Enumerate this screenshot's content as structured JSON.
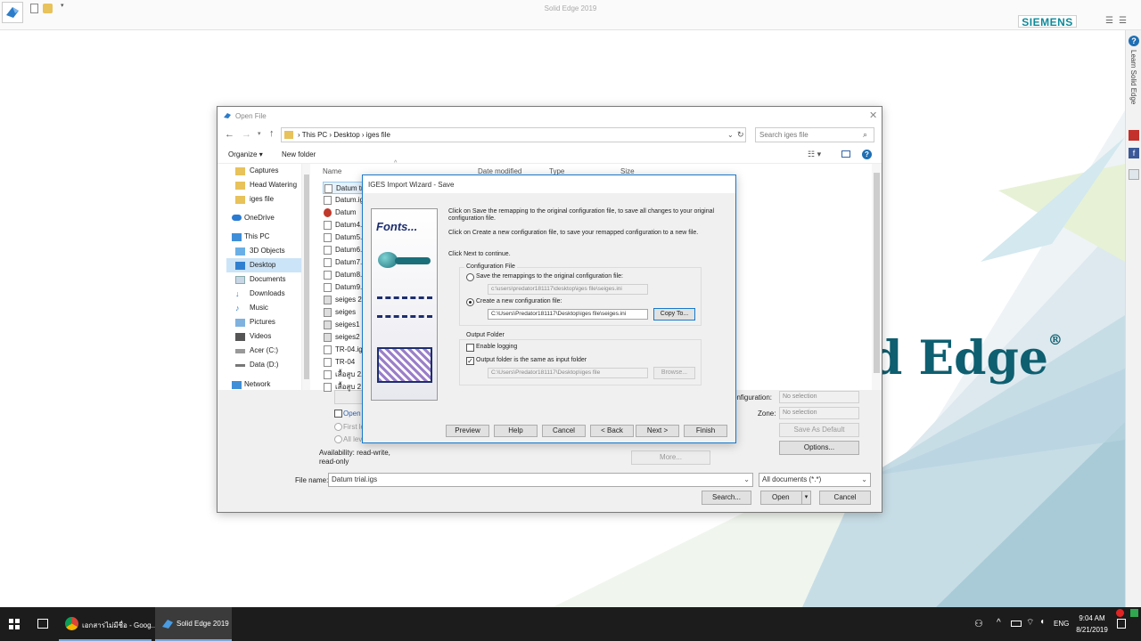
{
  "app": {
    "title": "Solid Edge 2019",
    "brand": "SIEMENS",
    "logo_text": "d Edge",
    "logo_reg": "®",
    "accent": "#0e6b7b"
  },
  "side_tab": {
    "label": "Learn Solid Edge",
    "help": "?"
  },
  "open_file": {
    "title": "Open File",
    "breadcrumb": [
      "This PC",
      "Desktop",
      "iges file"
    ],
    "search_placeholder": "Search iges file",
    "organize": "Organize",
    "new_folder": "New folder",
    "nav": [
      "Captures",
      "Head Watering",
      "iges file",
      "OneDrive",
      "This PC",
      "3D Objects",
      "Desktop",
      "Documents",
      "Downloads",
      "Music",
      "Pictures",
      "Videos",
      "Acer (C:)",
      "Data (D:)",
      "Network"
    ],
    "columns": [
      "Name",
      "Date modified",
      "Type",
      "Size"
    ],
    "files": [
      "Datum tr",
      "Datum.ig",
      "Datum",
      "Datum4.",
      "Datum5.",
      "Datum6.",
      "Datum7.",
      "Datum8.",
      "Datum9.",
      "seiges 2",
      "seiges",
      "seiges1",
      "seiges2",
      "TR-04.ig",
      "TR-04",
      "เสื้อสูบ 2.i",
      "เสื้อสูบ 2"
    ],
    "open_readonly": "Open",
    "first_level": "First le",
    "all_levels": "All lev",
    "availability": "Availability: read-write,",
    "availability2": "read-only",
    "config_label": "onfiguration:",
    "config_value": "No selection",
    "zone_label": "Zone:",
    "zone_value": "No selection",
    "save_default": "Save As Default",
    "options": "Options...",
    "more": "More...",
    "filename_label": "File name:",
    "filename_value": "Datum trial.igs",
    "filetype": "All documents (*.*)",
    "search_btn": "Search...",
    "open_btn": "Open",
    "cancel_btn": "Cancel"
  },
  "wizard": {
    "title": "IGES Import Wizard - Save",
    "side_image_text": "Fonts...",
    "p1": "Click on Save the remapping to the original configuration file, to save all changes to your original",
    "p1b": "configuration file.",
    "p2": "Click on Create a new configuration file, to save your remapped configuration to a new file.",
    "p3": "Click Next to continue.",
    "config_group": "Configuration File",
    "opt_save": "Save the remappings to the original configuration file:",
    "save_path": "c:\\users\\predator181117\\desktop\\iges file\\seiges.ini",
    "opt_create": "Create a new configuration file:",
    "create_path": "C:\\Users\\Predator181117\\Desktop\\iges file\\seiges.ini",
    "copy_to": "Copy To...",
    "output_group": "Output Folder",
    "enable_logging": "Enable logging",
    "same_folder": "Output folder is the same as input folder",
    "output_path": "C:\\Users\\Predator181117\\Desktop\\iges file",
    "browse": "Browse...",
    "buttons": {
      "preview": "Preview",
      "help": "Help",
      "cancel": "Cancel",
      "back": "< Back",
      "next": "Next >",
      "finish": "Finish"
    }
  },
  "taskbar": {
    "chrome_label": "เอกสารไม่มีชื่อ - Goog...",
    "solidedge_label": "Solid Edge 2019",
    "lang": "ENG",
    "time": "9:04 AM",
    "date": "8/21/2019"
  }
}
